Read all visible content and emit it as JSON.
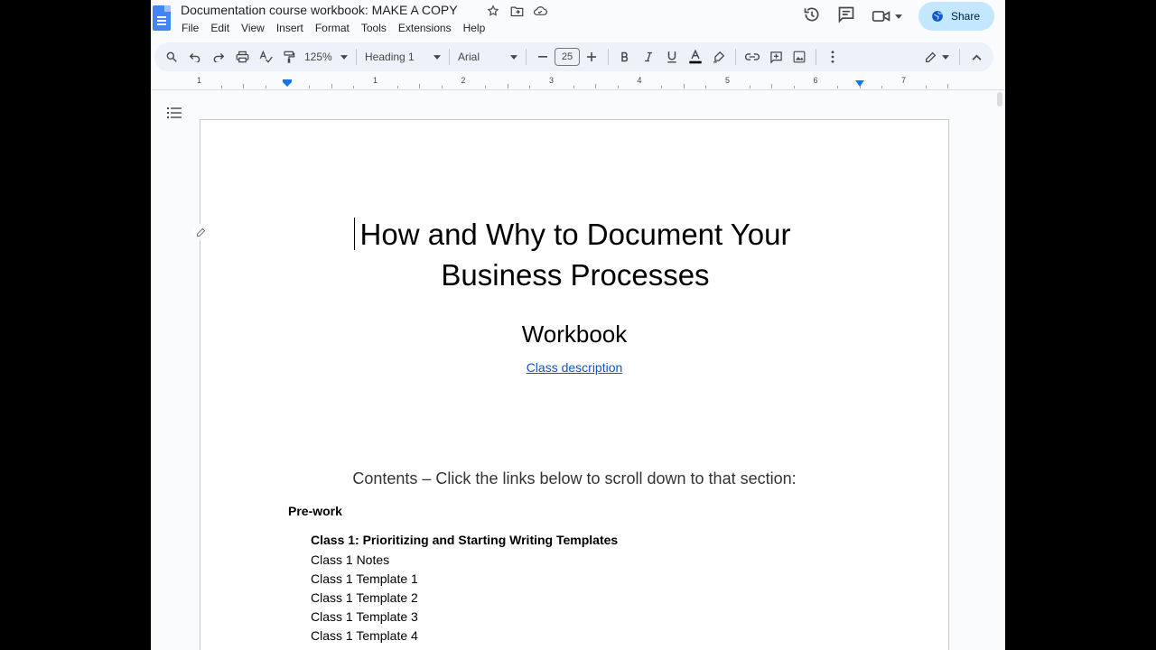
{
  "doc": {
    "title": "Documentation course workbook: MAKE A COPY",
    "share_label": "Share"
  },
  "menu": [
    "File",
    "Edit",
    "View",
    "Insert",
    "Format",
    "Tools",
    "Extensions",
    "Help"
  ],
  "toolbar": {
    "zoom": "125%",
    "style": "Heading 1",
    "font": "Arial",
    "font_size": "25"
  },
  "ruler": [
    "1",
    "1",
    "2",
    "3",
    "4",
    "5",
    "6",
    "7"
  ],
  "page": {
    "heading_line1": "How and Why to Document Your",
    "heading_line2": "Business Processes",
    "subtitle": "Workbook",
    "link": "Class description",
    "contents": "Contents – Click the links below to scroll down to that section:",
    "toc_prework": "Pre-work",
    "toc_class1": "Class 1: Prioritizing and Starting Writing Templates",
    "toc_items": [
      "Class 1 Notes",
      "Class 1 Template 1",
      "Class 1 Template 2",
      "Class 1 Template 3",
      "Class 1 Template 4"
    ]
  },
  "colors": {
    "accent": "#4285f4",
    "share_bg": "#c2e7ff",
    "toolbar_bg": "#edf2fa",
    "link": "#1155cc"
  },
  "icons": [
    "docs-logo-icon",
    "star-icon",
    "move-folder-icon",
    "cloud-status-icon",
    "version-history-icon",
    "comments-icon",
    "meet-icon",
    "globe-icon",
    "search-icon",
    "undo-icon",
    "redo-icon",
    "print-icon",
    "spellcheck-icon",
    "paint-format-icon",
    "bold-icon",
    "italic-icon",
    "underline-icon",
    "text-color-icon",
    "highlight-icon",
    "link-icon",
    "add-comment-icon",
    "insert-image-icon",
    "more-icon",
    "editing-mode-icon",
    "collapse-icon",
    "outline-icon"
  ]
}
